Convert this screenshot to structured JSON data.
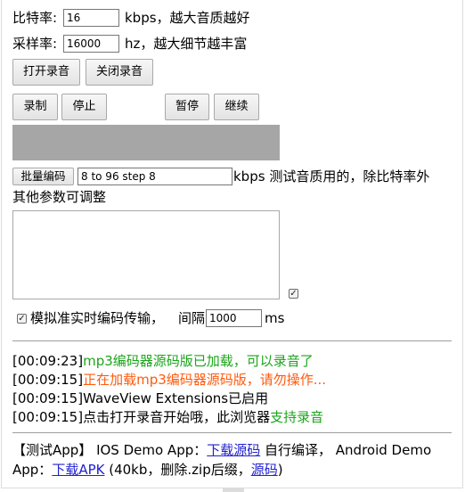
{
  "bitrate": {
    "label": "比特率:",
    "value": "16",
    "suffix": "kbps，越大音质越好"
  },
  "samplerate": {
    "label": "采样率:",
    "value": "16000",
    "suffix": "hz，越大细节越丰富"
  },
  "buttons": {
    "open": "打开录音",
    "close": "关闭录音",
    "record": "录制",
    "stop": "停止",
    "pause": "暂停",
    "resume": "继续",
    "batch": "批量编码"
  },
  "batch": {
    "value": "8 to 96 step 8",
    "desc_1": "kbps 测试音质用的，除比特率外",
    "desc_2": "其他参数可调整"
  },
  "realtime": {
    "label": "模拟准实时编码传输，",
    "interval_label": "间隔",
    "interval_value": "1000",
    "unit": "ms"
  },
  "logs": [
    {
      "time": "[00:09:23]",
      "msg": "mp3编码器源码版已加载，可以录音了",
      "color": "green"
    },
    {
      "time": "[00:09:15]",
      "msg": "正在加载mp3编码器源码版，请勿操作...",
      "color": "orange"
    },
    {
      "time": "[00:09:15]",
      "msg": "WaveView Extensions已启用",
      "color": "black"
    },
    {
      "time": "[00:09:15]",
      "msg_plain": "点击打开录音开始哦，此浏览器",
      "msg_green": "支持录音"
    }
  ],
  "footer": {
    "p1": "【测试App】 IOS Demo App：",
    "link1": "下载源码",
    "p2": " 自行编译， Android Demo App：",
    "link2": "下载APK",
    "p3": " (40kb，删除.zip后缀，",
    "link3": "源码",
    "p4": ")"
  },
  "colors": {
    "log_green": "#1aa61a",
    "log_orange": "#ff5a0e",
    "link": "#2222cc",
    "visual_bar": "#a6a6a6"
  }
}
